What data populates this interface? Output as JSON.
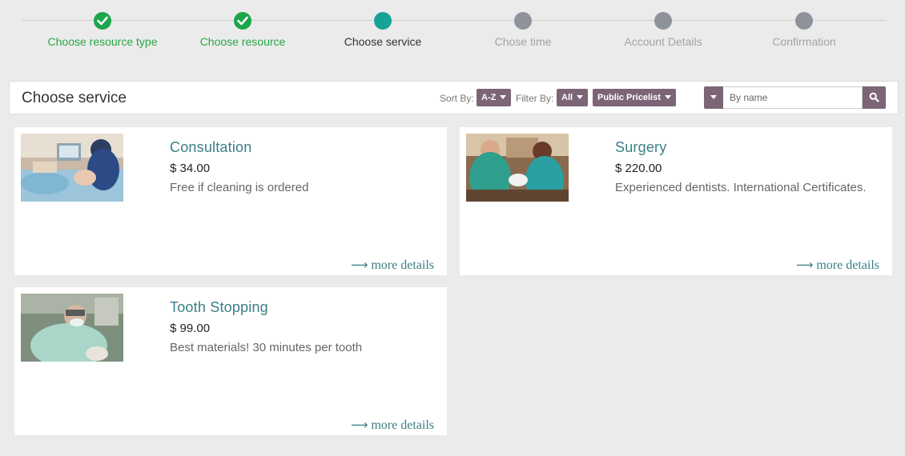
{
  "stepper": {
    "steps": [
      {
        "label": "Choose resource type",
        "status": "done"
      },
      {
        "label": "Choose resource",
        "status": "done"
      },
      {
        "label": "Choose service",
        "status": "current"
      },
      {
        "label": "Chose time",
        "status": "todo"
      },
      {
        "label": "Account Details",
        "status": "todo"
      },
      {
        "label": "Confirmation",
        "status": "todo"
      }
    ],
    "colors": {
      "done": "#1ca64b",
      "current": "#17a297",
      "todo": "#8e939a"
    }
  },
  "toolbar": {
    "title": "Choose service",
    "sort_label": "Sort By:",
    "sort_value": "A-Z",
    "filter_label": "Filter By:",
    "filter_value": "All",
    "pricelist_value": "Public Pricelist",
    "search_placeholder": "By name",
    "accent": "#7c6576"
  },
  "services": [
    {
      "name": "Consultation",
      "price": "$ 34.00",
      "description": "Free if cleaning is ordered",
      "more": "more details",
      "image": "dentist-consultation-photo"
    },
    {
      "name": "Surgery",
      "price": "$ 220.00",
      "description": "Experienced dentists. International Certificates.",
      "more": "more details",
      "image": "dental-surgery-photo"
    },
    {
      "name": "Tooth Stopping",
      "price": "$ 99.00",
      "description": "Best materials! 30 minutes per tooth",
      "more": "more details",
      "image": "tooth-stopping-photo"
    }
  ]
}
